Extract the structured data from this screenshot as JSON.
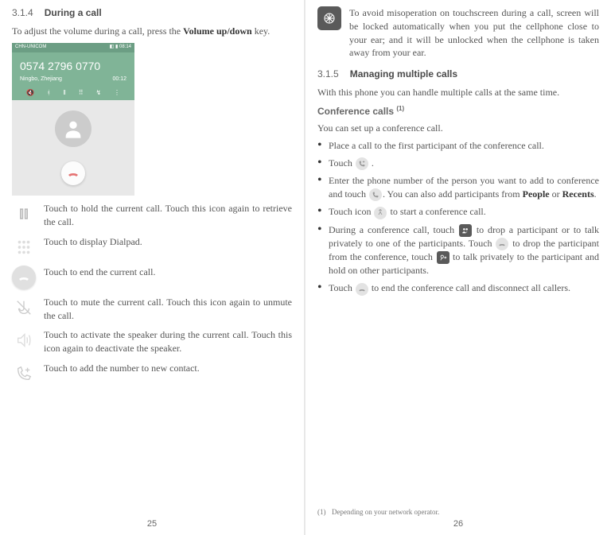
{
  "left": {
    "heading_num": "3.1.4",
    "heading_text": "During a call",
    "intro_1": "To adjust the volume during a call, press the ",
    "intro_bold": "Volume up/down",
    "intro_2": " key.",
    "shot": {
      "statusbar": {
        "carrier": "CHN-UNICOM",
        "time": "08:14"
      },
      "number": "0574 2796 0770",
      "location": "Ningbo, Zhejiang",
      "duration": "00:12"
    },
    "actions": {
      "hold": "Touch to hold the current call. Touch this icon again to retrieve the call.",
      "dialpad": "Touch to display Dialpad.",
      "end": "Touch to end the current call.",
      "mute": "Touch to mute the current call. Touch this icon again to unmute the call.",
      "speaker": "Touch to activate the speaker during the current call. Touch this icon again to deactivate the speaker.",
      "addcontact": "Touch to add the number to new contact."
    },
    "pagenum": "25"
  },
  "right": {
    "ear_note": "To avoid misoperation on touchscreen during a call, screen will be locked automatically when you put the cellphone close to your ear; and it will be unlocked when the cellphone is taken away from your ear.",
    "heading_num": "3.1.5",
    "heading_text": "Managing multiple calls",
    "intro": "With this phone you can handle multiple calls at the same time.",
    "conf_title": "Conference calls ",
    "conf_sup": "(1)",
    "conf_intro": "You can set up a conference call.",
    "bullets": {
      "b1": "Place a call to the first participant of the conference call.",
      "b2a": "Touch ",
      "b2b": " .",
      "b3a": "Enter the phone number of the person you want to add to conference and touch ",
      "b3b": ". You can also add participants from ",
      "b3_bold1": "People",
      "b3_or": " or ",
      "b3_bold2": "Recents",
      "b3c": ".",
      "b4a": "Touch icon ",
      "b4b": " to start a conference call.",
      "b5a": "During a conference call, touch ",
      "b5b": " to drop a participant or to talk privately to one of the participants. Touch ",
      "b5c": " to drop the participant from the conference, touch ",
      "b5d": " to talk privately to the participant and hold on other participants.",
      "b6a": "Touch ",
      "b6b": " to end the conference call and disconnect all callers."
    },
    "footnote_mark": "(1)",
    "footnote_text": "Depending on your network operator.",
    "pagenum": "26"
  }
}
